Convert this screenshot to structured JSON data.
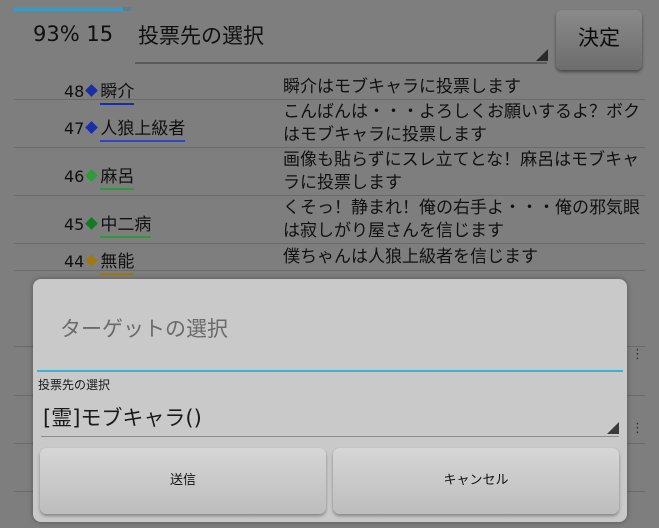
{
  "header": {
    "progress_fraction": 0.93,
    "status_text": "93% 15",
    "vote_select_label": "投票先の選択",
    "decide_label": "決定"
  },
  "log": {
    "rows": [
      {
        "num": "48",
        "name": "瞬介",
        "diamond_color": "#1a2ea8",
        "underline_color": "#1a2ea8",
        "message": "瞬介はモブキャラに投票します"
      },
      {
        "num": "47",
        "name": "人狼上級者",
        "diamond_color": "#1a2ea8",
        "underline_color": "#2a45c8",
        "message": "こんばんは・・・よろしくお願いするよ？ボクはモブキャラに投票します"
      },
      {
        "num": "46",
        "name": "麻呂",
        "diamond_color": "#2e9a3c",
        "underline_color": "#2e9a3c",
        "message": "画像も貼らずにスレ立てとな！麻呂はモブキャラに投票します"
      },
      {
        "num": "45",
        "name": "中二病",
        "diamond_color": "#137a2a",
        "underline_color": "#2e9a3c",
        "message": "くそっ！静まれ！俺の右手よ・・・俺の邪気眼は寂しがり屋さんを信じます"
      },
      {
        "num": "44",
        "name": "無能",
        "diamond_color": "#a07810",
        "underline_color": "#a07810",
        "message": "僕ちゃんは人狼上級者を信じます"
      }
    ]
  },
  "dialog": {
    "title": "ターゲットの選択",
    "field_label": "投票先の選択",
    "selected_value": "[霊]モブキャラ()",
    "send_label": "送信",
    "cancel_label": "キャンセル",
    "accent_color": "#38b4dc"
  }
}
